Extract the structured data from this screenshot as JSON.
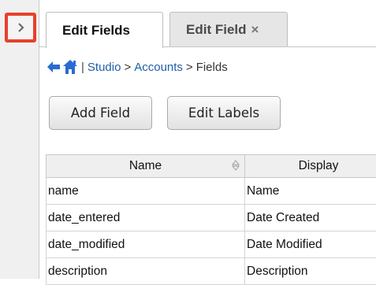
{
  "tabs": [
    {
      "label": "Edit Fields"
    },
    {
      "label": "Edit Field",
      "close": "×"
    }
  ],
  "breadcrumb": {
    "separator": "|",
    "items": [
      "Studio",
      "Accounts",
      "Fields"
    ],
    "gt": ">"
  },
  "buttons": {
    "add_field": "Add Field",
    "edit_labels": "Edit Labels"
  },
  "table": {
    "columns": [
      "Name",
      "Display"
    ],
    "rows": [
      [
        "name",
        "Name"
      ],
      [
        "date_entered",
        "Date Created"
      ],
      [
        "date_modified",
        "Date Modified"
      ],
      [
        "description",
        "Description"
      ]
    ]
  },
  "icons": {
    "expand": "chevron-right-icon",
    "back": "back-arrow-icon",
    "home": "home-icon",
    "sort": "sort-icon"
  },
  "colors": {
    "highlight": "#e8402b",
    "link": "#1f5fa8",
    "nav_icon": "#2a6bd1"
  }
}
